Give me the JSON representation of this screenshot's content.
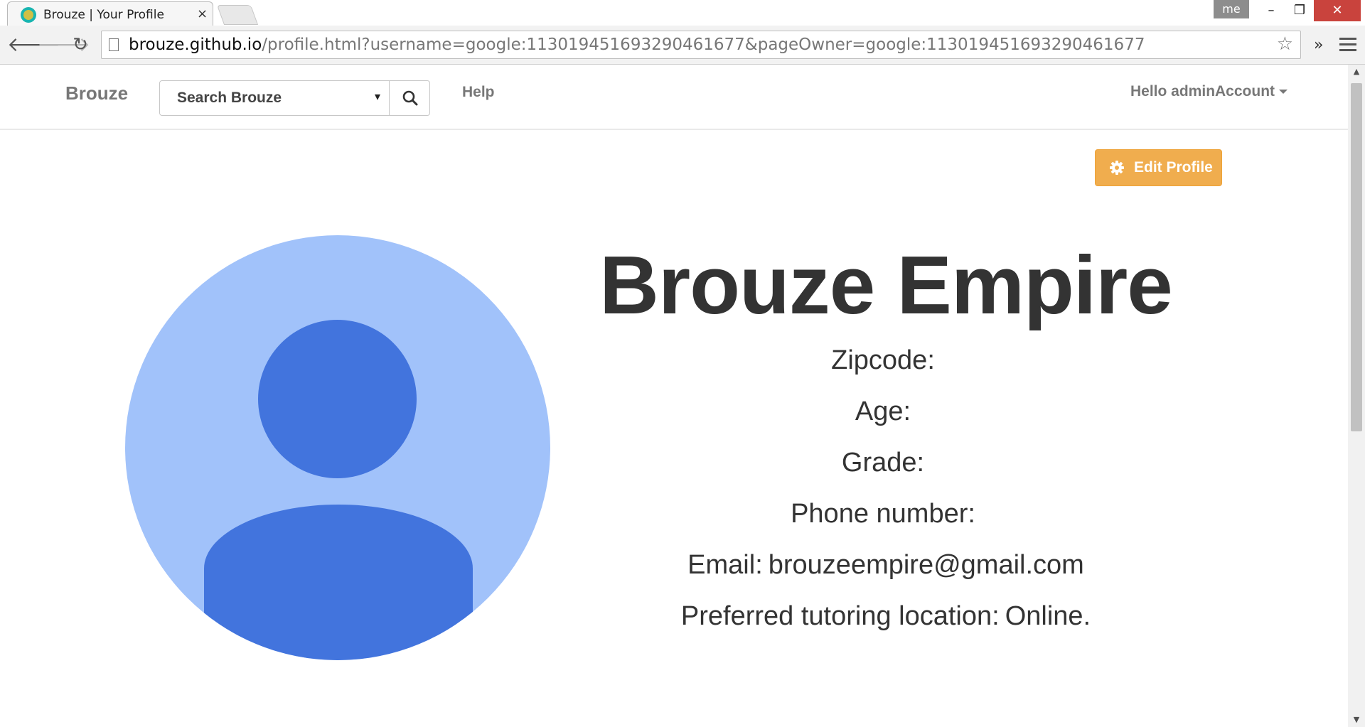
{
  "browser": {
    "tab_title": "Brouze | Your Profile",
    "tab_close": "×",
    "profile_badge": "me",
    "url_host": "brouze.github.io",
    "url_path": "/profile.html?username=google:113019451693290461677&pageOwner=google:113019451693290461677",
    "window_controls": {
      "minimize": "–",
      "maximize": "❐",
      "close": "✕"
    },
    "icons": [
      "back-arrow-icon",
      "forward-arrow-icon",
      "reload-icon",
      "page-icon",
      "star-icon",
      "chevron-double-icon",
      "menu-icon"
    ]
  },
  "navbar": {
    "brand": "Brouze",
    "search_placeholder": "Search Brouze",
    "help": "Help",
    "user_greeting": "Hello adminAccount"
  },
  "edit_button": {
    "label": "Edit Profile",
    "icon": "gear-icon",
    "color": "#f0ad4e"
  },
  "avatar": {
    "icon": "default-person-avatar",
    "bg_color": "#a1c2fa",
    "fg_color": "#4274dd"
  },
  "profile": {
    "name": "Brouze Empire",
    "fields": [
      {
        "label": "Zipcode:",
        "value": ""
      },
      {
        "label": "Age:",
        "value": ""
      },
      {
        "label": "Grade:",
        "value": ""
      },
      {
        "label": "Phone number:",
        "value": ""
      },
      {
        "label": "Email:",
        "value": "brouzeempire@gmail.com"
      },
      {
        "label": "Preferred tutoring location:",
        "value": "Online."
      }
    ]
  }
}
